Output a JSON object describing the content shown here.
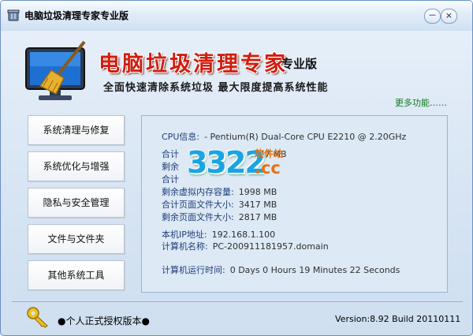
{
  "window": {
    "title": "电脑垃圾清理专家专业版",
    "minimize": "－",
    "close": "×"
  },
  "header": {
    "brand": "电脑垃圾清理专家",
    "edition": "专业版",
    "slogan": "全面快速清除系统垃圾   最大限度提高系统性能",
    "more_link": "更多功能……"
  },
  "nav": [
    {
      "label": "系统清理与修复"
    },
    {
      "label": "系统优化与增强"
    },
    {
      "label": "隐私与安全管理"
    },
    {
      "label": "文件与文件夹"
    },
    {
      "label": "其他系统工具"
    }
  ],
  "info": {
    "cpu": {
      "label": "CPU信息:",
      "value": "- Pentium(R) Dual-Core  CPU      E2210  @ 2.20GHz"
    },
    "rows1": [
      {
        "label": "合计",
        "value": "2047 MB"
      },
      {
        "label": "剩余",
        "value": ""
      },
      {
        "label": "合计",
        "value": ""
      },
      {
        "label": "剩余虚拟内存容量:",
        "value": "1998 MB"
      },
      {
        "label": "合计页面文件大小:",
        "value": "3417 MB"
      },
      {
        "label": "剩余页面文件大小:",
        "value": "2817 MB"
      }
    ],
    "ip": {
      "label": "本机IP地址:",
      "value": "192.168.1.100"
    },
    "computer": {
      "label": "计算机名称:",
      "value": "PC-200911181957.domain"
    },
    "uptime": {
      "label": "计算机运行时间:",
      "value": "0 Days 0 Hours 19 Minutes 22 Seconds"
    }
  },
  "watermark": {
    "number": "3322",
    "site_cn": "软件站",
    "site_domain": ".cc"
  },
  "footer": {
    "license": "●个人正式授权版本●",
    "version": "Version:8.92 Build 20110111"
  }
}
